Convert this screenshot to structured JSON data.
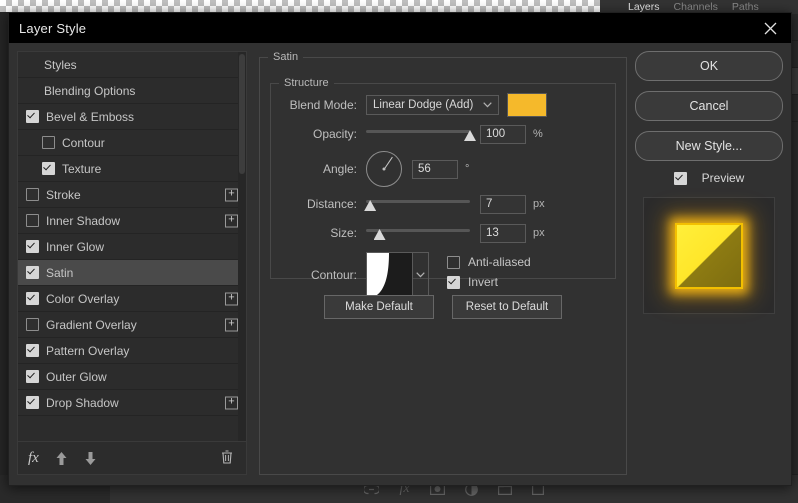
{
  "background": {
    "panel_tabs": [
      {
        "label": "Layers",
        "active": true
      },
      {
        "label": "Channels",
        "active": false
      },
      {
        "label": "Paths",
        "active": false
      }
    ],
    "bottom_icons": [
      "link-icon",
      "fx-icon",
      "layer-mask-icon",
      "adjustment-icon",
      "group-icon",
      "new-layer-icon"
    ]
  },
  "dialog": {
    "title": "Layer Style",
    "close_icon": "close-icon"
  },
  "styles_panel": {
    "items": [
      {
        "label": "Styles",
        "checkbox": "none",
        "indent": false,
        "plus": false,
        "selected": false
      },
      {
        "label": "Blending Options",
        "checkbox": "none",
        "indent": false,
        "plus": false,
        "selected": false
      },
      {
        "label": "Bevel & Emboss",
        "checkbox": "checked",
        "indent": false,
        "plus": false,
        "selected": false
      },
      {
        "label": "Contour",
        "checkbox": "unchecked",
        "indent": true,
        "plus": false,
        "selected": false
      },
      {
        "label": "Texture",
        "checkbox": "checked",
        "indent": true,
        "plus": false,
        "selected": false
      },
      {
        "label": "Stroke",
        "checkbox": "unchecked",
        "indent": false,
        "plus": true,
        "selected": false
      },
      {
        "label": "Inner Shadow",
        "checkbox": "unchecked",
        "indent": false,
        "plus": true,
        "selected": false
      },
      {
        "label": "Inner Glow",
        "checkbox": "checked",
        "indent": false,
        "plus": false,
        "selected": false
      },
      {
        "label": "Satin",
        "checkbox": "checked",
        "indent": false,
        "plus": false,
        "selected": true
      },
      {
        "label": "Color Overlay",
        "checkbox": "checked",
        "indent": false,
        "plus": true,
        "selected": false
      },
      {
        "label": "Gradient Overlay",
        "checkbox": "unchecked",
        "indent": false,
        "plus": true,
        "selected": false
      },
      {
        "label": "Pattern Overlay",
        "checkbox": "checked",
        "indent": false,
        "plus": false,
        "selected": false
      },
      {
        "label": "Outer Glow",
        "checkbox": "checked",
        "indent": false,
        "plus": false,
        "selected": false
      },
      {
        "label": "Drop Shadow",
        "checkbox": "checked",
        "indent": false,
        "plus": true,
        "selected": false
      }
    ],
    "footer": {
      "fx_icon": "fx-icon",
      "move_up_icon": "arrow-up-icon",
      "move_down_icon": "arrow-down-icon",
      "delete_icon": "trash-icon"
    },
    "plus_label": "+"
  },
  "satin": {
    "group_title": "Satin",
    "structure_title": "Structure",
    "blend_mode": {
      "label": "Blend Mode:",
      "value": "Linear Dodge (Add)",
      "color": "#f5b92b",
      "chevron": "chevron-down-icon"
    },
    "opacity": {
      "label": "Opacity:",
      "value": "100",
      "unit": "%",
      "percent": 100
    },
    "angle": {
      "label": "Angle:",
      "value": "56",
      "unit": "°",
      "degrees": 56
    },
    "distance": {
      "label": "Distance:",
      "value": "7",
      "unit": "px",
      "percent": 4
    },
    "size": {
      "label": "Size:",
      "value": "13",
      "unit": "px",
      "percent": 13
    },
    "contour": {
      "label": "Contour:",
      "chevron": "chevron-down-icon",
      "anti_aliased": {
        "label": "Anti-aliased",
        "checked": false
      },
      "invert": {
        "label": "Invert",
        "checked": true
      }
    },
    "make_default": "Make Default",
    "reset_to_default": "Reset to Default"
  },
  "actions": {
    "ok": "OK",
    "cancel": "Cancel",
    "new_style": "New Style...",
    "preview": {
      "label": "Preview",
      "checked": true
    }
  }
}
